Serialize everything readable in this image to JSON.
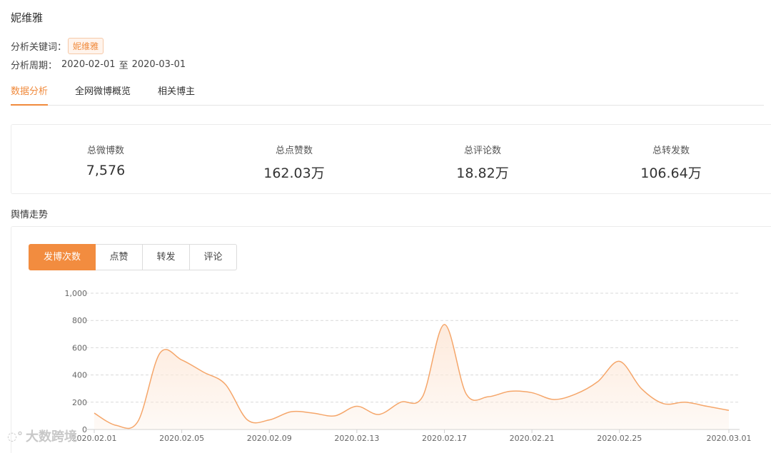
{
  "page": {
    "title": "妮维雅",
    "keyword_label": "分析关键词：",
    "keyword": "妮维雅",
    "period_label": "分析周期：",
    "period_start": "2020-02-01",
    "period_sep": "至",
    "period_end": "2020-03-01"
  },
  "tabs": [
    {
      "label": "数据分析",
      "active": true
    },
    {
      "label": "全网微博概览",
      "active": false
    },
    {
      "label": "相关博主",
      "active": false
    }
  ],
  "stats": [
    {
      "label": "总微博数",
      "value": "7,576"
    },
    {
      "label": "总点赞数",
      "value": "162.03万"
    },
    {
      "label": "总评论数",
      "value": "18.82万"
    },
    {
      "label": "总转发数",
      "value": "106.64万"
    }
  ],
  "trend": {
    "title": "舆情走势",
    "buttons": [
      {
        "label": "发博次数",
        "active": true
      },
      {
        "label": "点赞",
        "active": false
      },
      {
        "label": "转发",
        "active": false
      },
      {
        "label": "评论",
        "active": false
      }
    ]
  },
  "colors": {
    "accent": "#f28c3f",
    "line": "#f5a66a",
    "fill": "#fde9da"
  },
  "watermark": {
    "icon": "bubble-logo-icon",
    "text": "大数跨境"
  },
  "chart_data": {
    "type": "area",
    "x": [
      "2020.02.01",
      "2020.02.02",
      "2020.02.03",
      "2020.02.04",
      "2020.02.05",
      "2020.02.06",
      "2020.02.07",
      "2020.02.08",
      "2020.02.09",
      "2020.02.10",
      "2020.02.11",
      "2020.02.12",
      "2020.02.13",
      "2020.02.14",
      "2020.02.15",
      "2020.02.16",
      "2020.02.17",
      "2020.02.18",
      "2020.02.19",
      "2020.02.20",
      "2020.02.21",
      "2020.02.22",
      "2020.02.23",
      "2020.02.24",
      "2020.02.25",
      "2020.02.26",
      "2020.02.27",
      "2020.02.28",
      "2020.02.29",
      "2020.03.01"
    ],
    "x_tick_labels": [
      "2020.02.01",
      "2020.02.05",
      "2020.02.09",
      "2020.02.13",
      "2020.02.17",
      "2020.02.21",
      "2020.02.25",
      "2020.03.01"
    ],
    "x_tick_index": [
      0,
      4,
      8,
      12,
      16,
      20,
      24,
      29
    ],
    "series": [
      {
        "values": [
          120,
          30,
          60,
          560,
          510,
          420,
          330,
          70,
          70,
          130,
          120,
          100,
          170,
          110,
          200,
          240,
          770,
          260,
          240,
          280,
          270,
          220,
          260,
          350,
          500,
          300,
          190,
          200,
          170,
          140
        ]
      }
    ],
    "ylim": [
      0,
      1000
    ],
    "y_ticks": [
      0,
      200,
      400,
      600,
      800,
      1000
    ],
    "y_tick_labels": [
      "0",
      "200",
      "400",
      "600",
      "800",
      "1,000"
    ],
    "grid": true
  }
}
